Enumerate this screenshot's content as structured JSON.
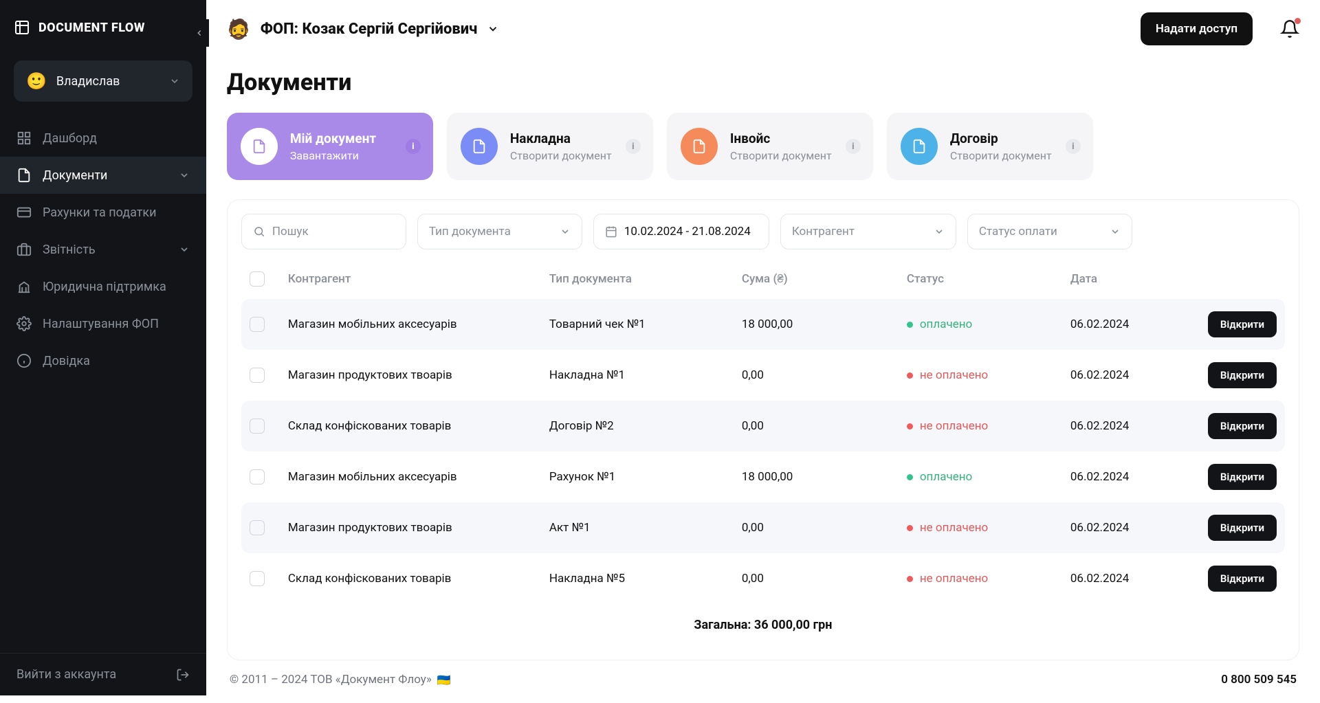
{
  "brand": "DOCUMENT FLOW",
  "user": {
    "emoji": "🙂",
    "name": "Владислав"
  },
  "nav": {
    "items": [
      {
        "icon": "grid-icon",
        "label": "Дашборд"
      },
      {
        "icon": "document-icon",
        "label": "Документи",
        "chevron": true,
        "active": true
      },
      {
        "icon": "card-icon",
        "label": "Рахунки та податки"
      },
      {
        "icon": "briefcase-icon",
        "label": "Звітність",
        "chevron": true
      },
      {
        "icon": "bank-icon",
        "label": "Юридична підтримка"
      },
      {
        "icon": "gear-icon",
        "label": "Налаштування ФОП"
      },
      {
        "icon": "info-icon",
        "label": "Довідка"
      }
    ],
    "logout": "Вийти з аккаунта"
  },
  "header": {
    "org_emoji": "🧔",
    "org_name": "ФОП: Козак Сергій Сергійович",
    "grant_button": "Надати доступ"
  },
  "page": {
    "title": "Документи"
  },
  "cards": [
    {
      "title": "Мій документ",
      "sub": "Завантажити",
      "variant": "primary"
    },
    {
      "title": "Накладна",
      "sub": "Створити документ",
      "btn_color": "cb-purple"
    },
    {
      "title": "Інвойс",
      "sub": "Створити документ",
      "btn_color": "cb-orange"
    },
    {
      "title": "Договір",
      "sub": "Створити документ",
      "btn_color": "cb-blue"
    }
  ],
  "filters": {
    "search_placeholder": "Пошук",
    "type_label": "Тип документа",
    "date_range": "10.02.2024 - 21.08.2024",
    "agent_label": "Контрагент",
    "status_label": "Статус оплати"
  },
  "table": {
    "columns": {
      "agent": "Контрагент",
      "type": "Тип документа",
      "amount": "Сума (₴)",
      "status": "Статус",
      "date": "Дата"
    },
    "status_labels": {
      "paid": "оплачено",
      "unpaid": "не оплачено"
    },
    "open_label": "Відкрити",
    "rows": [
      {
        "agent": "Магазин мобільних аксесуарів",
        "type": "Товарний чек №1",
        "amount": "18 000,00",
        "status": "paid",
        "date": "06.02.2024"
      },
      {
        "agent": "Магазин продуктових твоарів",
        "type": "Накладна №1",
        "amount": "0,00",
        "status": "unpaid",
        "date": "06.02.2024"
      },
      {
        "agent": "Склад конфіскованих товарів",
        "type": "Договір №2",
        "amount": "0,00",
        "status": "unpaid",
        "date": "06.02.2024"
      },
      {
        "agent": "Магазин мобільних аксесуарів",
        "type": "Рахунок №1",
        "amount": "18 000,00",
        "status": "paid",
        "date": "06.02.2024"
      },
      {
        "agent": "Магазин продуктових твоарів",
        "type": "Акт №1",
        "amount": "0,00",
        "status": "unpaid",
        "date": "06.02.2024"
      },
      {
        "agent": "Склад конфіскованих товарів",
        "type": "Накладна №5",
        "amount": "0,00",
        "status": "unpaid",
        "date": "06.02.2024"
      }
    ],
    "total": "Загальна: 36 000,00 грн"
  },
  "footer": {
    "copyright": "© 2011 – 2024 ТОВ «Документ Флоу»",
    "flag": "🇺🇦",
    "phone": "0 800 509 545"
  }
}
